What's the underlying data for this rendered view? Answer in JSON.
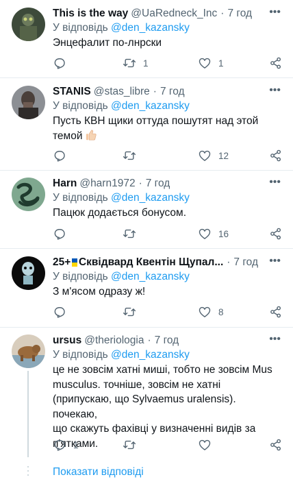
{
  "reply_prefix": "У відповідь",
  "tweets": [
    {
      "name": "This is the way",
      "handle": "@UaRedneck_Inc",
      "time": "7 год",
      "mention": "@den_kazansky",
      "text": "Энцефалит по-лнрски",
      "replies": "",
      "retweets": "1",
      "likes": "1"
    },
    {
      "name": "STANIS",
      "handle": "@stas_libre",
      "time": "7 год",
      "mention": "@den_kazansky",
      "text": "Пусть КВН щики оттуда пошутят над этой темой",
      "emoji": "thumbs-up",
      "replies": "",
      "retweets": "",
      "likes": "12"
    },
    {
      "name": "Harn",
      "handle": "@harn1972",
      "time": "7 год",
      "mention": "@den_kazansky",
      "text": "Пацюк додається бонусом.",
      "replies": "",
      "retweets": "",
      "likes": "16"
    },
    {
      "name_prefix": "25+",
      "name": "Сквідвард Квентін Щупал...",
      "time": "7 год",
      "mention": "@den_kazansky",
      "text": "З м'ясом одразу ж!",
      "replies": "",
      "retweets": "",
      "likes": "8"
    },
    {
      "name": "ursus",
      "handle": "@theriologia",
      "time": "7 год",
      "mention": "@den_kazansky",
      "text_lines": [
        "це не зовсім хатні миші, тобто не зовсім Mus",
        "musculus. точніше, зовсім не хатні",
        "(припускаю, що Sylvaemus uralensis). почекаю,",
        "що скажуть фахівці у визначенні видів за",
        "п'ятками."
      ],
      "replies": "1",
      "retweets": "",
      "likes": ""
    }
  ],
  "show_replies": "Показати відповіді",
  "colors": {
    "accent": "#1d9bf0",
    "secondary_text": "#536471",
    "primary_text": "#0f1419",
    "separator": "#e6ecf0"
  },
  "icons": [
    "more-icon",
    "reply-icon",
    "retweet-icon",
    "like-icon",
    "share-icon"
  ]
}
